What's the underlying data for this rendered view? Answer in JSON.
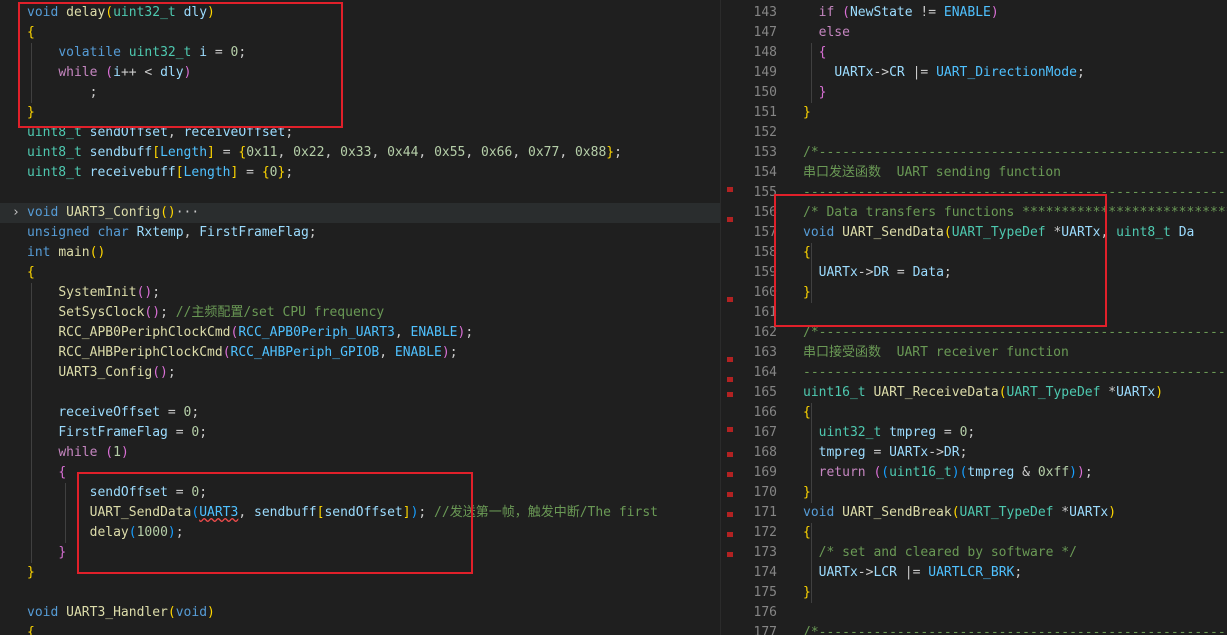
{
  "left_editor": {
    "lines": [
      [
        [
          "kw",
          "void"
        ],
        [
          "pl",
          " "
        ],
        [
          "fn",
          "delay"
        ],
        [
          "br1",
          "("
        ],
        [
          "ty",
          "uint32_t"
        ],
        [
          "pl",
          " "
        ],
        [
          "var",
          "dly"
        ],
        [
          "br1",
          ")"
        ]
      ],
      [
        [
          "br1",
          "{"
        ]
      ],
      [
        [
          "pl",
          "    "
        ],
        [
          "kw",
          "volatile"
        ],
        [
          "pl",
          " "
        ],
        [
          "ty",
          "uint32_t"
        ],
        [
          "pl",
          " "
        ],
        [
          "var",
          "i"
        ],
        [
          "pl",
          " = "
        ],
        [
          "num",
          "0"
        ],
        [
          "pl",
          ";"
        ]
      ],
      [
        [
          "pl",
          "    "
        ],
        [
          "ctl",
          "while"
        ],
        [
          "pl",
          " "
        ],
        [
          "br2",
          "("
        ],
        [
          "var",
          "i"
        ],
        [
          "pl",
          "++ < "
        ],
        [
          "var",
          "dly"
        ],
        [
          "br2",
          ")"
        ]
      ],
      [
        [
          "pl",
          "        ;"
        ]
      ],
      [
        [
          "br1",
          "}"
        ]
      ],
      [
        [
          "ty",
          "uint8_t"
        ],
        [
          "pl",
          " "
        ],
        [
          "var",
          "sendOffset"
        ],
        [
          "pl",
          ", "
        ],
        [
          "var",
          "receiveOffset"
        ],
        [
          "pl",
          ";"
        ]
      ],
      [
        [
          "ty",
          "uint8_t"
        ],
        [
          "pl",
          " "
        ],
        [
          "var",
          "sendbuff"
        ],
        [
          "br1",
          "["
        ],
        [
          "macro",
          "Length"
        ],
        [
          "br1",
          "]"
        ],
        [
          "pl",
          " = "
        ],
        [
          "br1",
          "{"
        ],
        [
          "num",
          "0x11"
        ],
        [
          "pl",
          ", "
        ],
        [
          "num",
          "0x22"
        ],
        [
          "pl",
          ", "
        ],
        [
          "num",
          "0x33"
        ],
        [
          "pl",
          ", "
        ],
        [
          "num",
          "0x44"
        ],
        [
          "pl",
          ", "
        ],
        [
          "num",
          "0x55"
        ],
        [
          "pl",
          ", "
        ],
        [
          "num",
          "0x66"
        ],
        [
          "pl",
          ", "
        ],
        [
          "num",
          "0x77"
        ],
        [
          "pl",
          ", "
        ],
        [
          "num",
          "0x88"
        ],
        [
          "br1",
          "}"
        ],
        [
          "pl",
          ";"
        ]
      ],
      [
        [
          "ty",
          "uint8_t"
        ],
        [
          "pl",
          " "
        ],
        [
          "var",
          "receivebuff"
        ],
        [
          "br1",
          "["
        ],
        [
          "macro",
          "Length"
        ],
        [
          "br1",
          "]"
        ],
        [
          "pl",
          " = "
        ],
        [
          "br1",
          "{"
        ],
        [
          "num",
          "0"
        ],
        [
          "br1",
          "}"
        ],
        [
          "pl",
          ";"
        ]
      ],
      [],
      [
        [
          "kw",
          "void"
        ],
        [
          "pl",
          " "
        ],
        [
          "fn",
          "UART3_Config"
        ],
        [
          "br1",
          "()"
        ],
        [
          "pl",
          "···"
        ]
      ],
      [
        [
          "kw",
          "unsigned"
        ],
        [
          "pl",
          " "
        ],
        [
          "kw",
          "char"
        ],
        [
          "pl",
          " "
        ],
        [
          "var",
          "Rxtemp"
        ],
        [
          "pl",
          ", "
        ],
        [
          "var",
          "FirstFrameFlag"
        ],
        [
          "pl",
          ";"
        ]
      ],
      [
        [
          "kw",
          "int"
        ],
        [
          "pl",
          " "
        ],
        [
          "fn",
          "main"
        ],
        [
          "br1",
          "()"
        ]
      ],
      [
        [
          "br1",
          "{"
        ]
      ],
      [
        [
          "pl",
          "    "
        ],
        [
          "fn",
          "SystemInit"
        ],
        [
          "br2",
          "()"
        ],
        [
          "pl",
          ";"
        ]
      ],
      [
        [
          "pl",
          "    "
        ],
        [
          "fn",
          "SetSysClock"
        ],
        [
          "br2",
          "()"
        ],
        [
          "pl",
          "; "
        ],
        [
          "cm",
          "//主频配置/set CPU frequency"
        ]
      ],
      [
        [
          "pl",
          "    "
        ],
        [
          "fn",
          "RCC_APB0PeriphClockCmd"
        ],
        [
          "br2",
          "("
        ],
        [
          "macro",
          "RCC_APB0Periph_UART3"
        ],
        [
          "pl",
          ", "
        ],
        [
          "macro",
          "ENABLE"
        ],
        [
          "br2",
          ")"
        ],
        [
          "pl",
          ";"
        ]
      ],
      [
        [
          "pl",
          "    "
        ],
        [
          "fn",
          "RCC_AHBPeriphClockCmd"
        ],
        [
          "br2",
          "("
        ],
        [
          "macro",
          "RCC_AHBPeriph_GPIOB"
        ],
        [
          "pl",
          ", "
        ],
        [
          "macro",
          "ENABLE"
        ],
        [
          "br2",
          ")"
        ],
        [
          "pl",
          ";"
        ]
      ],
      [
        [
          "pl",
          "    "
        ],
        [
          "fn",
          "UART3_Config"
        ],
        [
          "br2",
          "()"
        ],
        [
          "pl",
          ";"
        ]
      ],
      [],
      [
        [
          "pl",
          "    "
        ],
        [
          "var",
          "receiveOffset"
        ],
        [
          "pl",
          " = "
        ],
        [
          "num",
          "0"
        ],
        [
          "pl",
          ";"
        ]
      ],
      [
        [
          "pl",
          "    "
        ],
        [
          "var",
          "FirstFrameFlag"
        ],
        [
          "pl",
          " = "
        ],
        [
          "num",
          "0"
        ],
        [
          "pl",
          ";"
        ]
      ],
      [
        [
          "pl",
          "    "
        ],
        [
          "ctl",
          "while"
        ],
        [
          "pl",
          " "
        ],
        [
          "br2",
          "("
        ],
        [
          "num",
          "1"
        ],
        [
          "br2",
          ")"
        ]
      ],
      [
        [
          "pl",
          "    "
        ],
        [
          "br2",
          "{"
        ]
      ],
      [
        [
          "pl",
          "        "
        ],
        [
          "var",
          "sendOffset"
        ],
        [
          "pl",
          " = "
        ],
        [
          "num",
          "0"
        ],
        [
          "pl",
          ";"
        ]
      ],
      [
        [
          "pl",
          "        "
        ],
        [
          "fn",
          "UART_SendData"
        ],
        [
          "br3",
          "("
        ],
        [
          "macro",
          "UART3"
        ],
        [
          "pl",
          ", "
        ],
        [
          "var",
          "sendbuff"
        ],
        [
          "br1",
          "["
        ],
        [
          "var",
          "sendOffset"
        ],
        [
          "br1",
          "]"
        ],
        [
          "br3",
          ")"
        ],
        [
          "pl",
          "; "
        ],
        [
          "cm",
          "//发送第一帧，触发中断/The first"
        ]
      ],
      [
        [
          "pl",
          "        "
        ],
        [
          "fn",
          "delay"
        ],
        [
          "br3",
          "("
        ],
        [
          "num",
          "1000"
        ],
        [
          "br3",
          ")"
        ],
        [
          "pl",
          ";"
        ]
      ],
      [
        [
          "pl",
          "    "
        ],
        [
          "br2",
          "}"
        ]
      ],
      [
        [
          "br1",
          "}"
        ]
      ],
      [],
      [
        [
          "kw",
          "void"
        ],
        [
          "pl",
          " "
        ],
        [
          "fn",
          "UART3_Handler"
        ],
        [
          "br1",
          "("
        ],
        [
          "kw",
          "void"
        ],
        [
          "br1",
          ")"
        ]
      ],
      [
        [
          "br1",
          "{"
        ]
      ]
    ]
  },
  "right_editor": {
    "lines": [
      {
        "n": "143",
        "c": [
          [
            "pl",
            "  "
          ],
          [
            "ctl",
            "if"
          ],
          [
            "pl",
            " "
          ],
          [
            "br2",
            "("
          ],
          [
            "var",
            "NewState"
          ],
          [
            "pl",
            " != "
          ],
          [
            "macro",
            "ENABLE"
          ],
          [
            "br2",
            ")"
          ]
        ]
      },
      {
        "n": "147",
        "c": [
          [
            "pl",
            "  "
          ],
          [
            "ctl",
            "else"
          ]
        ]
      },
      {
        "n": "148",
        "c": [
          [
            "pl",
            "  "
          ],
          [
            "br2",
            "{"
          ]
        ]
      },
      {
        "n": "149",
        "c": [
          [
            "pl",
            "    "
          ],
          [
            "var",
            "UARTx"
          ],
          [
            "pl",
            "->"
          ],
          [
            "var",
            "CR"
          ],
          [
            "pl",
            " |= "
          ],
          [
            "macro",
            "UART_DirectionMode"
          ],
          [
            "pl",
            ";"
          ]
        ]
      },
      {
        "n": "150",
        "c": [
          [
            "pl",
            "  "
          ],
          [
            "br2",
            "}"
          ]
        ]
      },
      {
        "n": "151",
        "c": [
          [
            "br1",
            "}"
          ]
        ]
      },
      {
        "n": "152",
        "c": []
      },
      {
        "n": "153",
        "c": [
          [
            "cm",
            "/*-------------------------------------------------------"
          ]
        ]
      },
      {
        "n": "154",
        "c": [
          [
            "cm",
            "串口发送函数  UART sending function"
          ]
        ]
      },
      {
        "n": "155",
        "c": [
          [
            "cm",
            "-------------------------------------------------------"
          ]
        ]
      },
      {
        "n": "156",
        "c": [
          [
            "cm",
            "/* Data transfers functions ***************************"
          ]
        ]
      },
      {
        "n": "157",
        "c": [
          [
            "kw",
            "void"
          ],
          [
            "pl",
            " "
          ],
          [
            "fn",
            "UART_SendData"
          ],
          [
            "br1",
            "("
          ],
          [
            "ty",
            "UART_TypeDef"
          ],
          [
            "pl",
            " *"
          ],
          [
            "var",
            "UARTx"
          ],
          [
            "pl",
            ", "
          ],
          [
            "ty",
            "uint8_t"
          ],
          [
            "pl",
            " "
          ],
          [
            "var",
            "Da"
          ]
        ]
      },
      {
        "n": "158",
        "c": [
          [
            "br1",
            "{"
          ]
        ]
      },
      {
        "n": "159",
        "c": [
          [
            "pl",
            "  "
          ],
          [
            "var",
            "UARTx"
          ],
          [
            "pl",
            "->"
          ],
          [
            "var",
            "DR"
          ],
          [
            "pl",
            " = "
          ],
          [
            "var",
            "Data"
          ],
          [
            "pl",
            ";"
          ]
        ]
      },
      {
        "n": "160",
        "c": [
          [
            "br1",
            "}"
          ]
        ]
      },
      {
        "n": "161",
        "c": []
      },
      {
        "n": "162",
        "c": [
          [
            "cm",
            "/*-------------------------------------------------------"
          ]
        ]
      },
      {
        "n": "163",
        "c": [
          [
            "cm",
            "串口接受函数  UART receiver function"
          ]
        ]
      },
      {
        "n": "164",
        "c": [
          [
            "cm",
            "-------------------------------------------------------"
          ]
        ]
      },
      {
        "n": "165",
        "c": [
          [
            "ty",
            "uint16_t"
          ],
          [
            "pl",
            " "
          ],
          [
            "fn",
            "UART_ReceiveData"
          ],
          [
            "br1",
            "("
          ],
          [
            "ty",
            "UART_TypeDef"
          ],
          [
            "pl",
            " *"
          ],
          [
            "var",
            "UARTx"
          ],
          [
            "br1",
            ")"
          ]
        ]
      },
      {
        "n": "166",
        "c": [
          [
            "br1",
            "{"
          ]
        ]
      },
      {
        "n": "167",
        "c": [
          [
            "pl",
            "  "
          ],
          [
            "ty",
            "uint32_t"
          ],
          [
            "pl",
            " "
          ],
          [
            "var",
            "tmpreg"
          ],
          [
            "pl",
            " = "
          ],
          [
            "num",
            "0"
          ],
          [
            "pl",
            ";"
          ]
        ]
      },
      {
        "n": "168",
        "c": [
          [
            "pl",
            "  "
          ],
          [
            "var",
            "tmpreg"
          ],
          [
            "pl",
            " = "
          ],
          [
            "var",
            "UARTx"
          ],
          [
            "pl",
            "->"
          ],
          [
            "var",
            "DR"
          ],
          [
            "pl",
            ";"
          ]
        ]
      },
      {
        "n": "169",
        "c": [
          [
            "pl",
            "  "
          ],
          [
            "ctl",
            "return"
          ],
          [
            "pl",
            " "
          ],
          [
            "br2",
            "("
          ],
          [
            "br3",
            "("
          ],
          [
            "ty",
            "uint16_t"
          ],
          [
            "br3",
            ")"
          ],
          [
            "br3",
            "("
          ],
          [
            "var",
            "tmpreg"
          ],
          [
            "pl",
            " & "
          ],
          [
            "num",
            "0xff"
          ],
          [
            "br3",
            ")"
          ],
          [
            "br2",
            ")"
          ],
          [
            "pl",
            ";"
          ]
        ]
      },
      {
        "n": "170",
        "c": [
          [
            "br1",
            "}"
          ]
        ]
      },
      {
        "n": "171",
        "c": [
          [
            "kw",
            "void"
          ],
          [
            "pl",
            " "
          ],
          [
            "fn",
            "UART_SendBreak"
          ],
          [
            "br1",
            "("
          ],
          [
            "ty",
            "UART_TypeDef"
          ],
          [
            "pl",
            " *"
          ],
          [
            "var",
            "UARTx"
          ],
          [
            "br1",
            ")"
          ]
        ]
      },
      {
        "n": "172",
        "c": [
          [
            "br1",
            "{"
          ]
        ]
      },
      {
        "n": "173",
        "c": [
          [
            "pl",
            "  "
          ],
          [
            "cm",
            "/* set and cleared by software */"
          ]
        ]
      },
      {
        "n": "174",
        "c": [
          [
            "pl",
            "  "
          ],
          [
            "var",
            "UARTx"
          ],
          [
            "pl",
            "->"
          ],
          [
            "var",
            "LCR"
          ],
          [
            "pl",
            " |= "
          ],
          [
            "macro",
            "UARTLCR_BRK"
          ],
          [
            "pl",
            ";"
          ]
        ]
      },
      {
        "n": "175",
        "c": [
          [
            "br1",
            "}"
          ]
        ]
      },
      {
        "n": "176",
        "c": []
      },
      {
        "n": "177",
        "c": [
          [
            "cm",
            "/*-------------------------------------------------------"
          ]
        ]
      }
    ]
  },
  "highlight_color": "#e0202a"
}
